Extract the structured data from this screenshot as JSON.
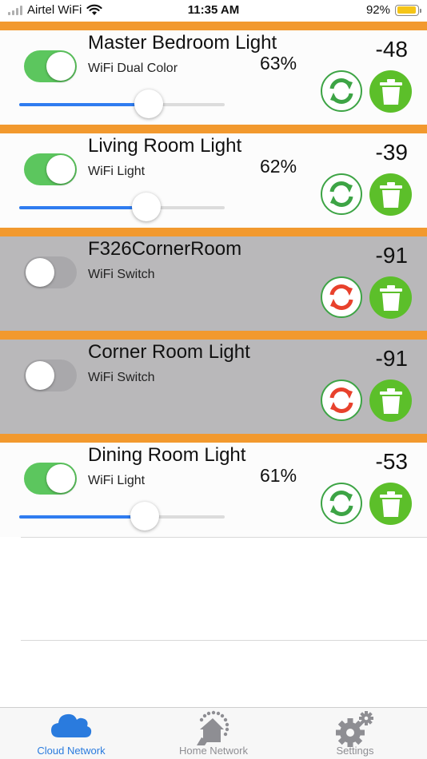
{
  "status_bar": {
    "carrier": "Airtel WiFi",
    "time": "11:35 AM",
    "battery_percent_text": "92%",
    "battery_level": 0.92,
    "signal_icon": "cellular-signal-icon",
    "wifi_icon": "wifi-icon"
  },
  "colors": {
    "accent_orange": "#f2992e",
    "toggle_on": "#5cc65e",
    "toggle_off": "#a9a8ab",
    "slider_blue": "#2f7cf0",
    "refresh_green": "#3da445",
    "refresh_red": "#e8412c",
    "delete_green": "#5cbf2a",
    "offline_bg": "#b9b8ba",
    "tab_active": "#2a7bde"
  },
  "devices": [
    {
      "name": "Master Bedroom Light",
      "type": "WiFi Dual Color",
      "level_text": "63%",
      "level": 0.63,
      "rssi": "-48",
      "on": true,
      "online": true,
      "slider": true
    },
    {
      "name": "Living Room Light",
      "type": "WiFi Light",
      "level_text": "62%",
      "level": 0.62,
      "rssi": "-39",
      "on": true,
      "online": true,
      "slider": true
    },
    {
      "name": "F326CornerRoom",
      "type": "WiFi Switch",
      "level_text": "",
      "level": null,
      "rssi": "-91",
      "on": false,
      "online": false,
      "slider": false
    },
    {
      "name": "Corner Room Light",
      "type": "WiFi Switch",
      "level_text": "",
      "level": null,
      "rssi": "-91",
      "on": false,
      "online": false,
      "slider": false
    },
    {
      "name": "Dining Room Light",
      "type": "WiFi Light",
      "level_text": "61%",
      "level": 0.61,
      "rssi": "-53",
      "on": true,
      "online": true,
      "slider": true
    }
  ],
  "tabs": [
    {
      "label": "Cloud Network",
      "icon": "cloud-icon",
      "active": true
    },
    {
      "label": "Home Network",
      "icon": "home-network-icon",
      "active": false
    },
    {
      "label": "Settings",
      "icon": "gear-icon",
      "active": false
    }
  ]
}
